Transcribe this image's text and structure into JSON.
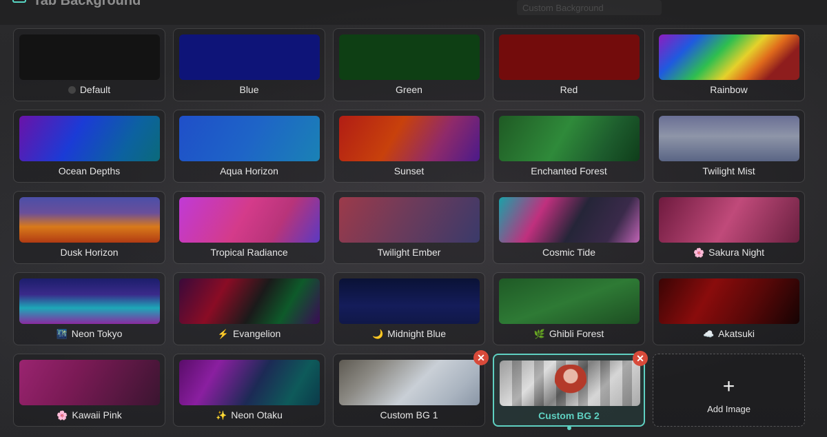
{
  "header": {
    "title": "Tab Background",
    "ghost_text": "Custom Background"
  },
  "cards": [
    {
      "label": "Default",
      "emoji": "",
      "style": "default"
    },
    {
      "label": "Blue",
      "emoji": "",
      "style": "blue"
    },
    {
      "label": "Green",
      "emoji": "",
      "style": "green"
    },
    {
      "label": "Red",
      "emoji": "",
      "style": "red"
    },
    {
      "label": "Rainbow",
      "emoji": "",
      "style": "rainbow"
    },
    {
      "label": "Ocean Depths",
      "emoji": "",
      "style": "ocean"
    },
    {
      "label": "Aqua Horizon",
      "emoji": "",
      "style": "aqua"
    },
    {
      "label": "Sunset",
      "emoji": "",
      "style": "sunset"
    },
    {
      "label": "Enchanted Forest",
      "emoji": "",
      "style": "forest"
    },
    {
      "label": "Twilight Mist",
      "emoji": "",
      "style": "mist"
    },
    {
      "label": "Dusk Horizon",
      "emoji": "",
      "style": "dusk"
    },
    {
      "label": "Tropical Radiance",
      "emoji": "",
      "style": "tropical"
    },
    {
      "label": "Twilight Ember",
      "emoji": "",
      "style": "ember"
    },
    {
      "label": "Cosmic Tide",
      "emoji": "",
      "style": "cosmic"
    },
    {
      "label": "Sakura Night",
      "emoji": "🌸",
      "style": "sakura"
    },
    {
      "label": "Neon Tokyo",
      "emoji": "🌃",
      "style": "tokyo"
    },
    {
      "label": "Evangelion",
      "emoji": "⚡",
      "style": "eva"
    },
    {
      "label": "Midnight Blue",
      "emoji": "🌙",
      "style": "midnight"
    },
    {
      "label": "Ghibli Forest",
      "emoji": "🌿",
      "style": "ghibli"
    },
    {
      "label": "Akatsuki",
      "emoji": "☁️",
      "style": "akatsuki"
    },
    {
      "label": "Kawaii Pink",
      "emoji": "🌸",
      "style": "kawaii"
    },
    {
      "label": "Neon Otaku",
      "emoji": "✨",
      "style": "otaku"
    }
  ],
  "custom": [
    {
      "label": "Custom BG 1",
      "remove_symbol": "✕"
    },
    {
      "label": "Custom BG 2",
      "remove_symbol": "✕",
      "selected": true
    }
  ],
  "add": {
    "plus": "+",
    "label": "Add Image"
  },
  "colors": {
    "accent": "#5fd1c2",
    "remove": "#d84a3a"
  }
}
